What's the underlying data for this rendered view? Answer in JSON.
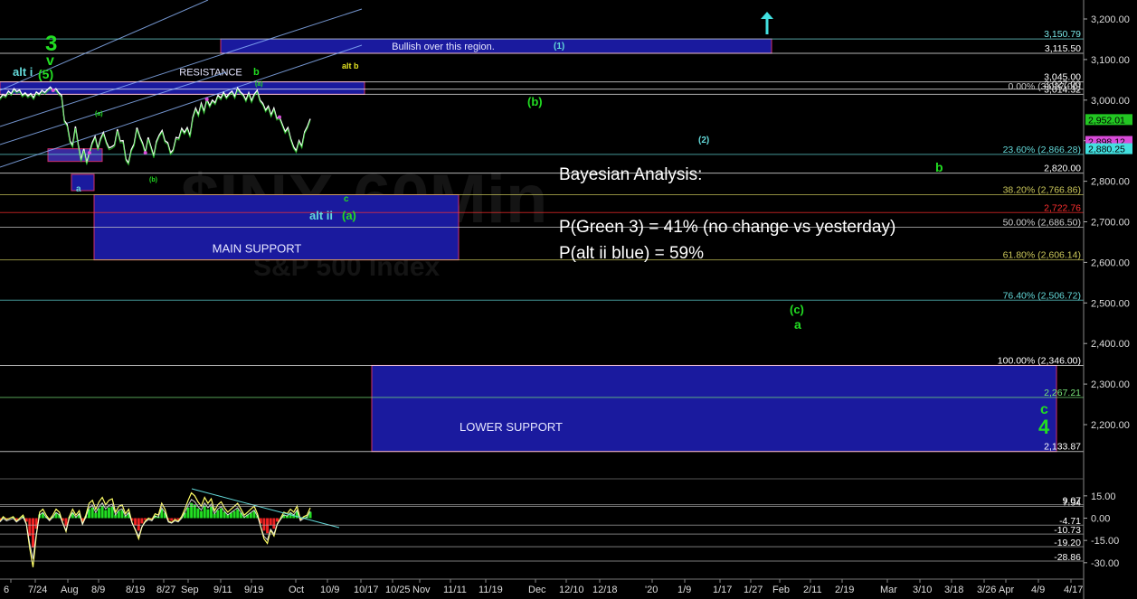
{
  "chart_data": {
    "type": "line",
    "watermark": {
      "symbol": "$INX,60Min",
      "name": "S&P 500 Index"
    },
    "price_axis": {
      "min": 2100,
      "max": 3200,
      "ticks": [
        "3,200.00",
        "3,100.00",
        "3,000.00",
        "2,900.00",
        "2,800.00",
        "2,700.00",
        "2,600.00",
        "2,500.00",
        "2,400.00",
        "2,300.00",
        "2,200.00"
      ],
      "tick_values": [
        3200,
        3100,
        3000,
        2900,
        2800,
        2700,
        2600,
        2500,
        2400,
        2300,
        2200
      ]
    },
    "osc_axis": {
      "min": -34,
      "max": 17,
      "ticks": [
        "15.00",
        "0.00",
        "-15.00",
        "-30.00"
      ],
      "tick_values": [
        15,
        0,
        -15,
        -30
      ]
    },
    "x_labels": [
      "6",
      "7/24",
      "Aug",
      "8/9",
      "8/19",
      "8/27",
      "Sep",
      "9/11",
      "9/19",
      "Oct",
      "10/9",
      "10/17",
      "10/25",
      "Nov",
      "11/11",
      "11/19",
      "Dec",
      "12/10",
      "12/18",
      "'20",
      "1/9",
      "1/17",
      "1/27",
      "Feb",
      "2/11",
      "2/19",
      "Mar",
      "3/10",
      "3/18",
      "3/26",
      "Apr",
      "4/9",
      "4/17"
    ],
    "levels": [
      {
        "value": 3150.79,
        "label": "3,150.79",
        "color": "#79e6e6"
      },
      {
        "value": 3115.5,
        "label": "3,115.50",
        "color": "#ffffff"
      },
      {
        "value": 3045.0,
        "label": "3,045.00",
        "color": "#ffffff"
      },
      {
        "value": 3027.0,
        "label": "3,027.00",
        "color": "#ffffff"
      },
      {
        "value": 3014.32,
        "label": "3,014.32",
        "color": "#ffffff"
      },
      {
        "value": 2866.28,
        "label": "23.60% (2,866.28)",
        "color": "#63d9d9"
      },
      {
        "value": 2820.0,
        "label": "2,820.00",
        "color": "#ffffff"
      },
      {
        "value": 2766.86,
        "label": "38.20% (2,766.86)",
        "color": "#cbc75a"
      },
      {
        "value": 2722.76,
        "label": "2,722.76",
        "color": "#ff3030"
      },
      {
        "value": 2686.5,
        "label": "50.00% (2,686.50)",
        "color": "#cccccc"
      },
      {
        "value": 2606.14,
        "label": "61.80% (2,606.14)",
        "color": "#cbc75a"
      },
      {
        "value": 2506.72,
        "label": "76.40% (2,506.72)",
        "color": "#63d9d9"
      },
      {
        "value": 2346.0,
        "label": "100.00% (2,346.00)",
        "color": "#ffffff"
      },
      {
        "value": 2267.21,
        "label": "2,267.21",
        "color": "#79e679"
      },
      {
        "value": 2133.87,
        "label": "2,133.87",
        "color": "#ffffff"
      }
    ],
    "fib_zero": {
      "value": 3033,
      "label": "0.00% (3,027.00)"
    },
    "price_badges": [
      {
        "value": 2952.01,
        "label": "2,952.01",
        "bg": "#22c622",
        "fg": "#000000"
      },
      {
        "value": 2898.12,
        "label": "2,898.12",
        "bg": "#d94bd9",
        "fg": "#000000"
      },
      {
        "value": 2880.25,
        "label": "2,880.25",
        "bg": "#42e0e0",
        "fg": "#000000"
      }
    ],
    "zones": [
      {
        "name": "bullish",
        "label": "Bullish over this region.",
        "top": 3150.79,
        "bottom": 3115.5
      },
      {
        "name": "resistance",
        "label": "RESISTANCE",
        "top": 3045.0,
        "bottom": 3014.32
      },
      {
        "name": "main-support",
        "label": "MAIN SUPPORT",
        "top": 2766.86,
        "bottom": 2606.14
      },
      {
        "name": "lower-support",
        "label": "LOWER SUPPORT",
        "top": 2346.0,
        "bottom": 2133.87
      }
    ],
    "wave_labels": [
      {
        "text": "3",
        "color": "#22dd22",
        "size": "big"
      },
      {
        "text": "v",
        "color": "#22dd22",
        "size": "med"
      },
      {
        "text": "(5)",
        "color": "#22dd22",
        "size": "med"
      },
      {
        "text": "alt i",
        "color": "#63d9d9",
        "size": "med"
      },
      {
        "text": "b",
        "color": "#22dd22",
        "size": "small"
      },
      {
        "text": "(a)",
        "color": "#22dd22",
        "size": "tiny"
      },
      {
        "text": "alt b",
        "color": "#e6e622",
        "size": "small"
      },
      {
        "text": "(b)",
        "color": "#22dd22",
        "size": "med"
      },
      {
        "text": "(1)",
        "color": "#63d9d9",
        "size": "small"
      },
      {
        "text": "(2)",
        "color": "#63d9d9",
        "size": "small"
      },
      {
        "text": "b",
        "color": "#22dd22",
        "size": "med"
      },
      {
        "text": "a",
        "color": "#63d9d9",
        "size": "small"
      },
      {
        "text": "c",
        "color": "#22dd22",
        "size": "small"
      },
      {
        "text": "alt ii",
        "color": "#63d9d9",
        "size": "med"
      },
      {
        "text": "(a)",
        "color": "#22dd22",
        "size": "med"
      },
      {
        "text": "(c)",
        "color": "#22dd22",
        "size": "med"
      },
      {
        "text": "a",
        "color": "#22dd22",
        "size": "med"
      },
      {
        "text": "c",
        "color": "#22dd22",
        "size": "med"
      },
      {
        "text": "4",
        "color": "#22dd22",
        "size": "big"
      },
      {
        "text": "(a)",
        "color": "#22dd22",
        "size": "tiny"
      },
      {
        "text": "(b)",
        "color": "#22dd22",
        "size": "tiny"
      }
    ],
    "analysis": {
      "heading": "Bayesian Analysis:",
      "line1": "P(Green 3) = 41% (no change vs yesterday)",
      "line2": "P(alt ii blue) = 59%"
    },
    "series": [
      {
        "name": "price",
        "color": "#ffffff",
        "values": [
          3005,
          3014,
          3010,
          3022,
          3016,
          3028,
          3021,
          3025,
          3012,
          3018,
          3010,
          3016,
          3006,
          3020,
          3015,
          3024,
          3019,
          3026,
          3032,
          3024,
          3028,
          3018,
          3012,
          2950,
          2940,
          2900,
          2888,
          2935,
          2890,
          2852,
          2880,
          2845,
          2870,
          2895,
          2910,
          2880,
          2905,
          2920,
          2897,
          2882,
          2885,
          2890,
          2928,
          2899,
          2900,
          2855,
          2845,
          2878,
          2892,
          2932,
          2910,
          2894,
          2870,
          2908,
          2885,
          2862,
          2898,
          2914,
          2925,
          2900,
          2895,
          2870,
          2878,
          2908,
          2906,
          2930,
          2920,
          2932,
          2912,
          2958,
          2980,
          2964,
          2992,
          2972,
          3002,
          2986,
          3000,
          2993,
          3012,
          3005,
          3019,
          3007,
          3016,
          3022,
          3008,
          3030,
          3020,
          3014,
          3000,
          3018,
          2998,
          3015,
          3024,
          3000,
          2992,
          2975,
          2985,
          2963,
          2980,
          2955,
          2958,
          2940,
          2922,
          2932,
          2905,
          2885,
          2875,
          2900,
          2886,
          2922,
          2935,
          2954
        ]
      },
      {
        "name": "oscillator",
        "color": "#ffff66",
        "values": [
          -2,
          1,
          -1,
          0,
          1,
          -2,
          0,
          2,
          -4,
          -20,
          -33,
          -12,
          4,
          6,
          2,
          -1,
          2,
          6,
          4,
          -3,
          -9,
          1,
          6,
          2,
          5,
          -4,
          2,
          10,
          12,
          6,
          11,
          14,
          9,
          12,
          13,
          4,
          8,
          9,
          3,
          6,
          -3,
          -8,
          -14,
          -6,
          -2,
          0,
          -1,
          3,
          2,
          10,
          6,
          -2,
          -3,
          -1,
          -2,
          1,
          6,
          12,
          17,
          15,
          11,
          8,
          14,
          10,
          13,
          5,
          9,
          11,
          7,
          4,
          6,
          8,
          10,
          6,
          2,
          4,
          6,
          8,
          3,
          -6,
          -14,
          -17,
          -8,
          -12,
          -4,
          0,
          4,
          3,
          6,
          4,
          8,
          -1,
          1,
          2,
          7
        ]
      }
    ],
    "histogram_colors": {
      "up": "#22dd22",
      "down": "#ee2222"
    },
    "osc_levels": [
      {
        "value": 9.07,
        "label": "9.07"
      },
      {
        "value": 7.94,
        "label": "7.94"
      },
      {
        "value": -4.71,
        "label": "-4.71"
      },
      {
        "value": -10.73,
        "label": "-10.73"
      },
      {
        "value": -19.2,
        "label": "-19.20"
      },
      {
        "value": -28.86,
        "label": "-28.86"
      }
    ]
  }
}
